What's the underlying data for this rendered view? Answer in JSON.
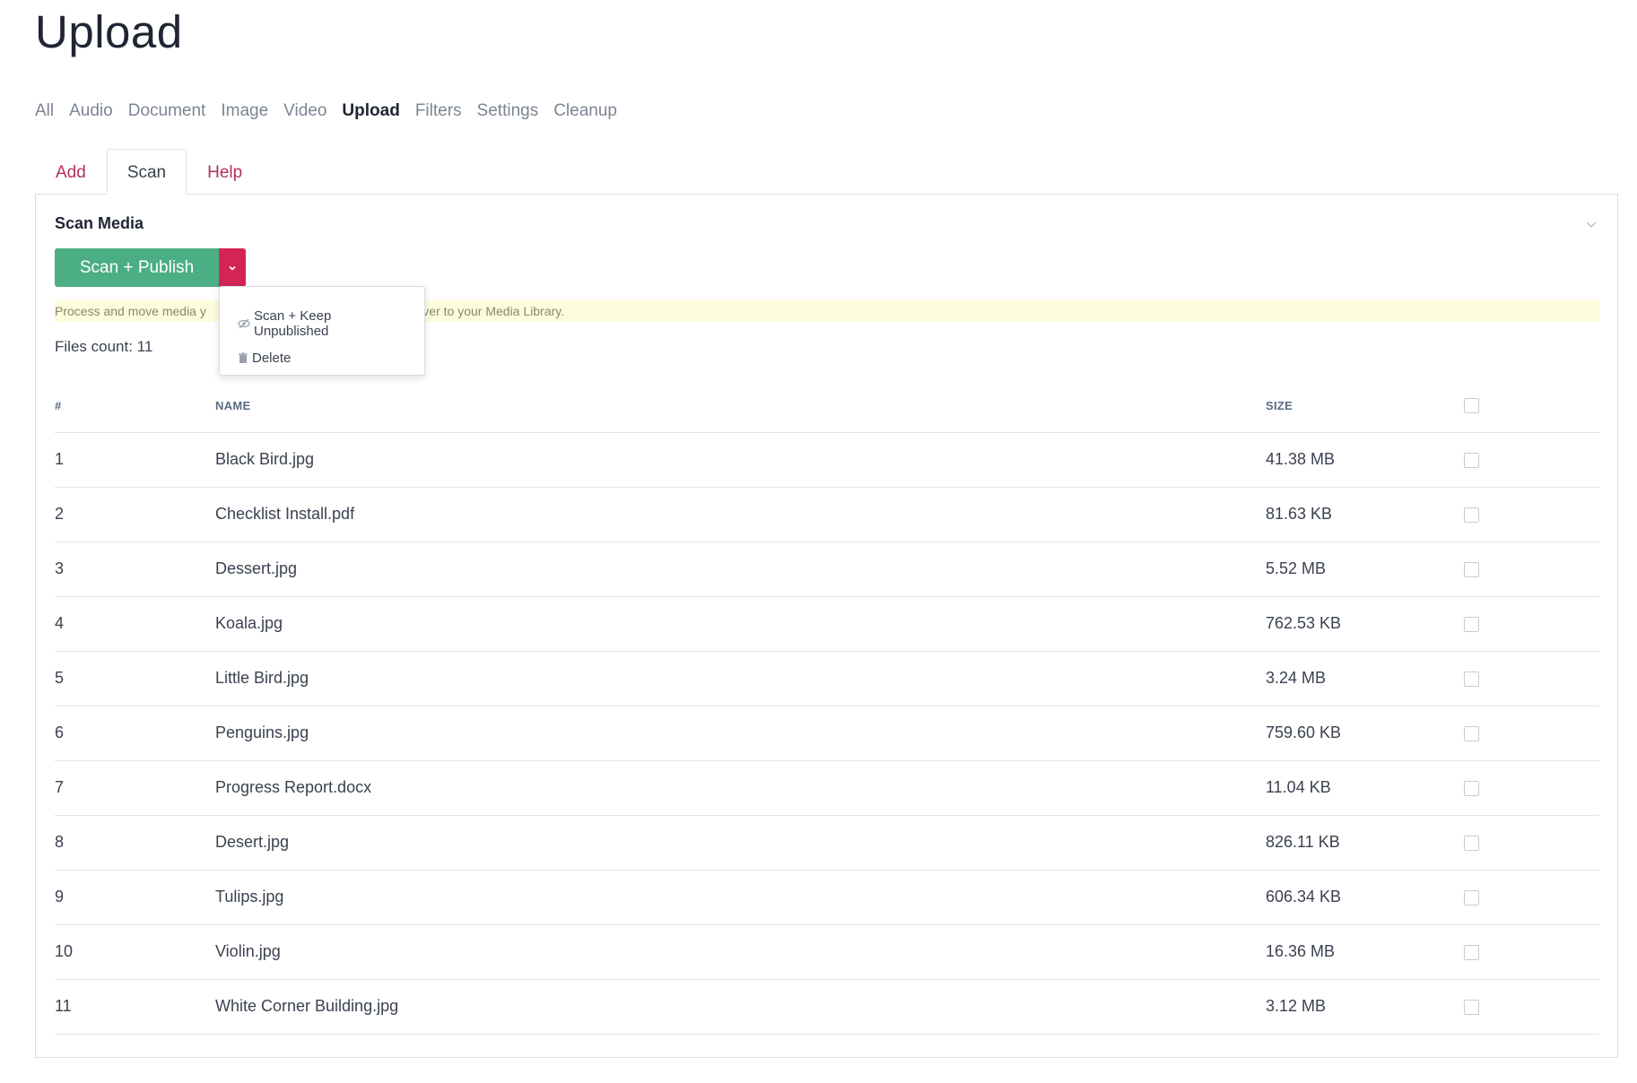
{
  "page": {
    "title": "Upload"
  },
  "main_nav": [
    "All",
    "Audio",
    "Document",
    "Image",
    "Video",
    "Upload",
    "Filters",
    "Settings",
    "Cleanup"
  ],
  "main_nav_active": "Upload",
  "sub_tabs": [
    "Add",
    "Scan",
    "Help"
  ],
  "sub_tabs_active": "Scan",
  "panel": {
    "title": "Scan Media",
    "primary_button": "Scan + Publish",
    "info_text": "Process and move media y",
    "info_text_tail": "erver to your Media Library.",
    "files_count": "Files count: 11"
  },
  "dropdown": {
    "items": [
      {
        "label": "Scan + Keep Unpublished",
        "icon": "eye-slash-icon"
      },
      {
        "label": "Delete",
        "icon": "trash-icon"
      }
    ]
  },
  "table": {
    "headers": [
      "#",
      "NAME",
      "SIZE"
    ],
    "rows": [
      {
        "num": "1",
        "name": "Black Bird.jpg",
        "size": "41.38 MB"
      },
      {
        "num": "2",
        "name": "Checklist Install.pdf",
        "size": "81.63 KB"
      },
      {
        "num": "3",
        "name": "Dessert.jpg",
        "size": "5.52 MB"
      },
      {
        "num": "4",
        "name": "Koala.jpg",
        "size": "762.53 KB"
      },
      {
        "num": "5",
        "name": "Little Bird.jpg",
        "size": "3.24 MB"
      },
      {
        "num": "6",
        "name": "Penguins.jpg",
        "size": "759.60 KB"
      },
      {
        "num": "7",
        "name": "Progress Report.docx",
        "size": "11.04 KB"
      },
      {
        "num": "8",
        "name": "Desert.jpg",
        "size": "826.11 KB"
      },
      {
        "num": "9",
        "name": "Tulips.jpg",
        "size": "606.34 KB"
      },
      {
        "num": "10",
        "name": "Violin.jpg",
        "size": "16.36 MB"
      },
      {
        "num": "11",
        "name": "White Corner Building.jpg",
        "size": "3.12 MB"
      }
    ]
  },
  "colors": {
    "primary": "#4cae84",
    "danger": "#d22556",
    "link": "#b3305f",
    "info_bg": "#fdfcdc"
  }
}
